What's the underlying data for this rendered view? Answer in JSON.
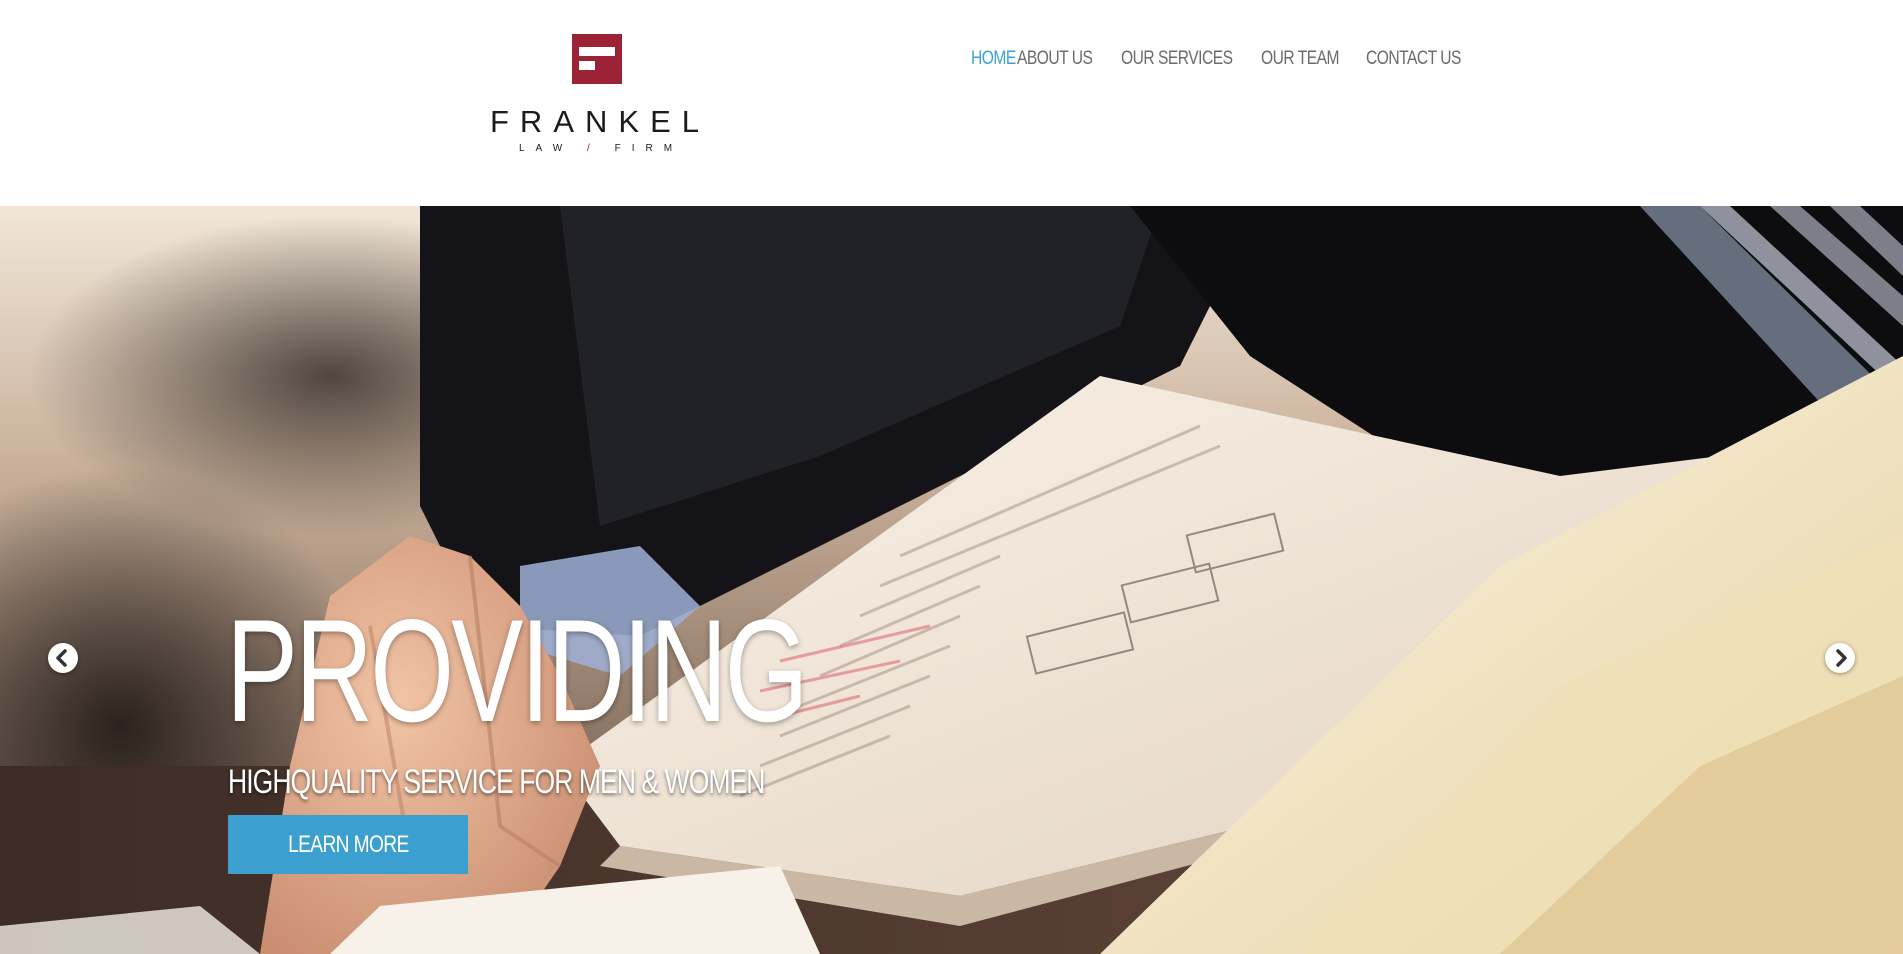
{
  "brand": {
    "name": "FRANKEL",
    "sub_left": "LAW",
    "sub_sep": "/",
    "sub_right": "FIRM",
    "mark_color": "#9b2335"
  },
  "nav": {
    "items": [
      {
        "label": "HOME",
        "active": true
      },
      {
        "label": "ABOUT US",
        "active": false
      },
      {
        "label": "OUR SERVICES",
        "active": false
      },
      {
        "label": "OUR TEAM",
        "active": false
      },
      {
        "label": "CONTACT US",
        "active": false
      }
    ],
    "active_color": "#3aa3d3",
    "color": "#6b6b6b"
  },
  "hero": {
    "title": "PROVIDING",
    "subtitle": "HIGHQUALITY SERVICE FOR MEN & WOMEN",
    "cta_label": "LEARN MORE",
    "cta_color": "#3b9fcf",
    "prev_icon": "chevron-left-icon",
    "next_icon": "chevron-right-icon"
  }
}
